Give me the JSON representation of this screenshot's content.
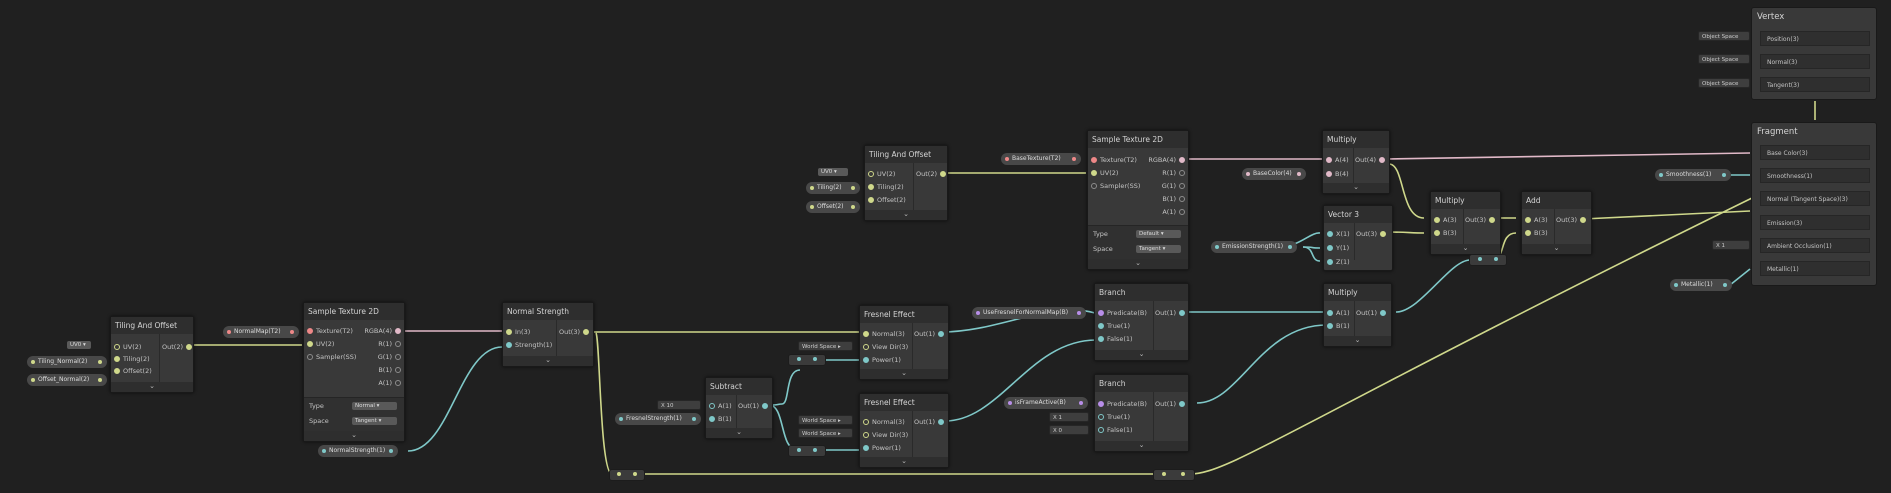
{
  "tiling1": {
    "title": "Tiling And Offset",
    "uv": "UV(2)",
    "tiling": "Tiling(2)",
    "offset": "Offset(2)",
    "out": "Out(2)",
    "chev": "⌄"
  },
  "tiling1_inputs": {
    "uv": "UV0",
    "tiling": "Tiling_Normal(2)",
    "offset": "Offset_Normal(2)"
  },
  "sample1": {
    "title": "Sample Texture 2D",
    "texture": "Texture(T2)",
    "uv": "UV(2)",
    "sampler": "Sampler(SS)",
    "rgba": "RGBA(4)",
    "r": "R(1)",
    "g": "G(1)",
    "b": "B(1)",
    "a": "A(1)",
    "type_label": "Type",
    "type_value": "Normal",
    "space_label": "Space",
    "space_value": "Tangent",
    "chev": "⌄"
  },
  "sample1_inputs": {
    "texture": "NormalMap(T2)"
  },
  "normalstrength": {
    "title": "Normal Strength",
    "in": "In(3)",
    "strength": "Strength(1)",
    "out": "Out(3)",
    "chev": "⌄"
  },
  "normalstrength_input": "NormalStrength(1)",
  "tiling2": {
    "title": "Tiling And Offset",
    "uv": "UV(2)",
    "tiling": "Tiling(2)",
    "offset": "Offset(2)",
    "out": "Out(2)",
    "chev": "⌄"
  },
  "tiling2_inputs": {
    "uv": "UV0",
    "tiling": "Tiling(2)",
    "offset": "Offset(2)"
  },
  "sample2": {
    "title": "Sample Texture 2D",
    "texture": "Texture(T2)",
    "uv": "UV(2)",
    "sampler": "Sampler(SS)",
    "rgba": "RGBA(4)",
    "r": "R(1)",
    "g": "G(1)",
    "b": "B(1)",
    "a": "A(1)",
    "type_label": "Type",
    "type_value": "Default",
    "space_label": "Space",
    "space_value": "Tangent",
    "chev": "⌄"
  },
  "sample2_inputs": {
    "texture": "BaseTexture(T2)"
  },
  "multiply1": {
    "title": "Multiply",
    "a": "A(4)",
    "b": "B(4)",
    "out": "Out(4)",
    "chev": "⌄"
  },
  "basecolor_input": "BaseColor(4)",
  "vector3": {
    "title": "Vector 3",
    "x": "X(1)",
    "y": "Y(1)",
    "z": "Z(1)",
    "out": "Out(3)"
  },
  "emission_input": "EmissionStrength(1)",
  "multiply2": {
    "title": "Multiply",
    "a": "A(3)",
    "b": "B(3)",
    "out": "Out(3)",
    "chev": "⌄"
  },
  "add": {
    "title": "Add",
    "a": "A(3)",
    "b": "B(3)",
    "out": "Out(3)",
    "chev": "⌄"
  },
  "subtract": {
    "title": "Subtract",
    "a": "A(1)",
    "b": "B(1)",
    "out": "Out(1)",
    "chev": "⌄",
    "x_label": "X",
    "x_value": "10"
  },
  "fresnel_strength_input": "FresnelStrength(1)",
  "fresnel1": {
    "title": "Fresnel Effect",
    "normal": "Normal(3)",
    "view": "View Dir(3)",
    "power": "Power(1)",
    "out": "Out(1)",
    "chev": "⌄",
    "ws": "World Space"
  },
  "fresnel2": {
    "title": "Fresnel Effect",
    "normal": "Normal(3)",
    "view": "View Dir(3)",
    "power": "Power(1)",
    "out": "Out(1)",
    "chev": "⌄",
    "ws1": "World Space",
    "ws2": "World Space"
  },
  "branch1": {
    "title": "Branch",
    "predicate": "Predicate(B)",
    "true": "True(1)",
    "false": "False(1)",
    "out": "Out(1)",
    "chev": "⌄"
  },
  "usefresnel_input": "UseFresnelForNormalMap(B)",
  "branch2": {
    "title": "Branch",
    "predicate": "Predicate(B)",
    "true": "True(1)",
    "false": "False(1)",
    "out": "Out(1)",
    "chev": "⌄",
    "x1_label": "X",
    "x1_value": "1",
    "x2_label": "X",
    "x2_value": "0"
  },
  "isframe_input": "isFrameActive(B)",
  "multiply3": {
    "title": "Multiply",
    "a": "A(1)",
    "b": "B(1)",
    "out": "Out(1)",
    "chev": "⌄"
  },
  "vertex": {
    "title": "Vertex",
    "position": "Position(3)",
    "normal": "Normal(3)",
    "tangent": "Tangent(3)",
    "space1": "Object Space",
    "space2": "Object Space",
    "space3": "Object Space"
  },
  "fragment": {
    "title": "Fragment",
    "base_color": "Base Color(3)",
    "smoothness": "Smoothness(1)",
    "normal_ts": "Normal (Tangent Space)(3)",
    "emission": "Emission(3)",
    "ao": "Ambient Occlusion(1)",
    "metallic": "Metallic(1)",
    "ao_x_label": "X",
    "ao_x_value": "1"
  },
  "frag_inputs": {
    "smoothness": "Smoothness(1)",
    "metallic": "Metallic(1)"
  },
  "colors": {
    "yellow": "#cfd88b",
    "teal": "#7fc8c8",
    "pink": "#e1b9c8",
    "background": "#202020",
    "node": "#393939"
  }
}
